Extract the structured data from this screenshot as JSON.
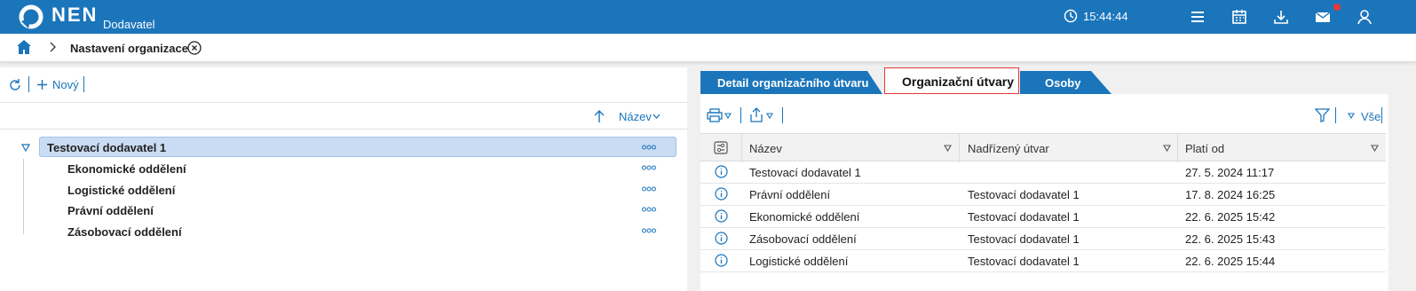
{
  "header": {
    "logo_text": "NEN",
    "logo_sub": "Dodavatel",
    "clock": "15:44:44",
    "icons": [
      "menu-icon",
      "calendar-icon",
      "download-icon",
      "mail-icon",
      "user-icon"
    ],
    "accent": "#1b75bb"
  },
  "breadcrumb": {
    "current": "Nastavení organizace"
  },
  "left_panel": {
    "toolbar": {
      "new_label": "Nový"
    },
    "sort": {
      "label": "Název"
    },
    "tree": {
      "root": "Testovací dodavatel 1",
      "children": [
        "Ekonomické oddělení",
        "Logistické oddělení",
        "Právní oddělení",
        "Zásobovací oddělení"
      ]
    }
  },
  "right_panel": {
    "tabs": [
      "Detail organizačního útvaru",
      "Organizační útvary",
      "Osoby"
    ],
    "active_tab": "Organizační útvary",
    "toolbar": {
      "filter_label": "Vše"
    },
    "columns": [
      "Název",
      "Nadřízený útvar",
      "Platí od"
    ],
    "rows": [
      {
        "nazev": "Testovací dodavatel 1",
        "nadrizeny": "",
        "plati_od": "27. 5. 2024 11:17"
      },
      {
        "nazev": "Právní oddělení",
        "nadrizeny": "Testovací dodavatel 1",
        "plati_od": "17. 8. 2024 16:25"
      },
      {
        "nazev": "Ekonomické oddělení",
        "nadrizeny": "Testovací dodavatel 1",
        "plati_od": "22. 6. 2025 15:42"
      },
      {
        "nazev": "Zásobovací oddělení",
        "nadrizeny": "Testovací dodavatel 1",
        "plati_od": "22. 6. 2025 15:43"
      },
      {
        "nazev": "Logistické oddělení",
        "nadrizeny": "Testovací dodavatel 1",
        "plati_od": "22. 6. 2025 15:44"
      }
    ]
  }
}
